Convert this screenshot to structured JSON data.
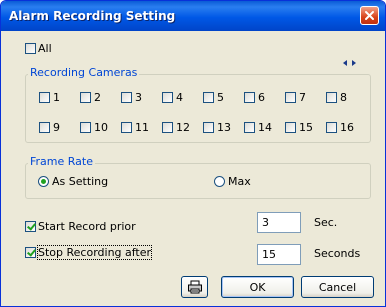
{
  "window": {
    "title": "Alarm Recording Setting"
  },
  "all_checkbox": {
    "label": "All",
    "checked": false
  },
  "cameras_group": {
    "title": "Recording Cameras",
    "cameras": [
      {
        "label": "1",
        "checked": false
      },
      {
        "label": "2",
        "checked": false
      },
      {
        "label": "3",
        "checked": false
      },
      {
        "label": "4",
        "checked": false
      },
      {
        "label": "5",
        "checked": false
      },
      {
        "label": "6",
        "checked": false
      },
      {
        "label": "7",
        "checked": false
      },
      {
        "label": "8",
        "checked": false
      },
      {
        "label": "9",
        "checked": false
      },
      {
        "label": "10",
        "checked": false
      },
      {
        "label": "11",
        "checked": false
      },
      {
        "label": "12",
        "checked": false
      },
      {
        "label": "13",
        "checked": false
      },
      {
        "label": "14",
        "checked": false
      },
      {
        "label": "15",
        "checked": false
      },
      {
        "label": "16",
        "checked": false
      }
    ]
  },
  "frame_rate": {
    "title": "Frame Rate",
    "options": [
      {
        "label": "As Setting",
        "selected": true
      },
      {
        "label": "Max",
        "selected": false
      }
    ]
  },
  "start_record": {
    "label": "Start Record prior",
    "checked": true,
    "value": "3",
    "unit": "Sec."
  },
  "stop_record": {
    "label": "Stop Recording after",
    "checked": true,
    "value": "15",
    "unit": "Seconds"
  },
  "buttons": {
    "ok": "OK",
    "cancel": "Cancel"
  },
  "icons": {
    "close": "close-icon",
    "prev_page": "arrow-left-icon",
    "next_page": "arrow-right-icon",
    "device": "printer-icon"
  },
  "colors": {
    "titlebar": "#0058e6",
    "group_title": "#0046d5",
    "check": "#21a121",
    "close": "#d8431a"
  }
}
